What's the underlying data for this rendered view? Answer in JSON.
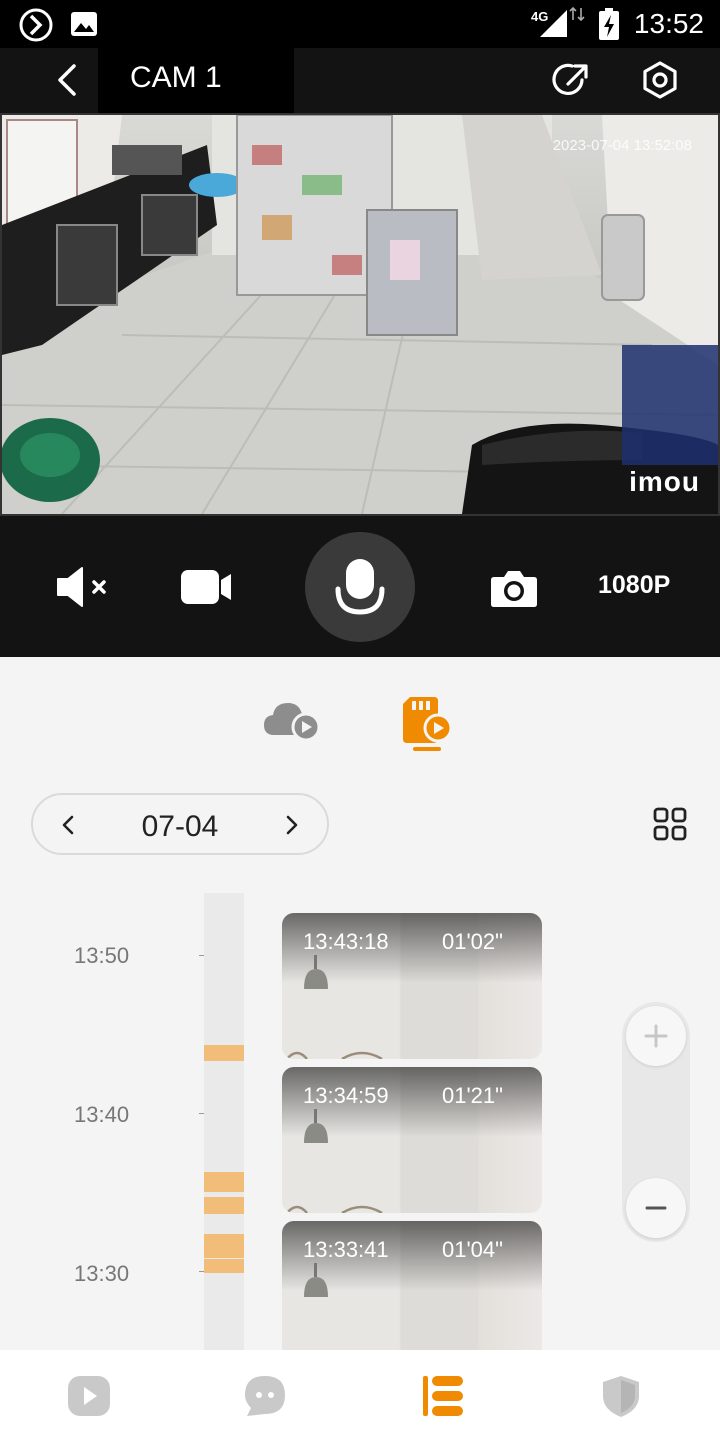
{
  "status_bar": {
    "time": "13:52",
    "network": "4G",
    "icons": [
      "app-logo-icon",
      "image-notification-icon",
      "signal-icon",
      "battery-charging-icon"
    ]
  },
  "header": {
    "title": "CAM 1",
    "icons": [
      "back-icon",
      "share-icon",
      "settings-icon"
    ]
  },
  "camera": {
    "timestamp": "2023-07-04 13:52:08",
    "brand": "imou"
  },
  "controls": {
    "icons": [
      "mute-icon",
      "record-icon",
      "microphone-icon",
      "snapshot-icon"
    ],
    "resolution": "1080P"
  },
  "source_tabs": {
    "items": [
      "cloud-playback-icon",
      "sd-card-playback-icon"
    ],
    "active": "sd-card-playback-icon",
    "accent": "#f08a00"
  },
  "date_picker": {
    "date": "07-04"
  },
  "timeline": {
    "labels": [
      "13:50",
      "13:40",
      "13:30"
    ],
    "segment_color": "#f2bd78"
  },
  "clips": [
    {
      "start": "13:43:18",
      "duration": "01'02\""
    },
    {
      "start": "13:34:59",
      "duration": "01'21\""
    },
    {
      "start": "13:33:41",
      "duration": "01'04\""
    }
  ],
  "bottom_nav": {
    "items": [
      "live-icon",
      "messages-icon",
      "playback-list-icon",
      "security-icon"
    ],
    "active": "playback-list-icon"
  }
}
